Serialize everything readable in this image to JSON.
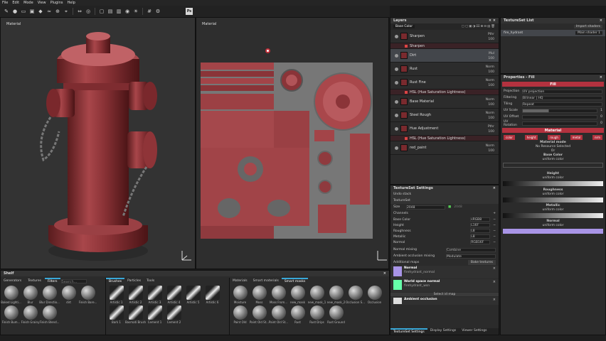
{
  "menu": [
    "File",
    "Edit",
    "Mode",
    "View",
    "Plugins",
    "Help"
  ],
  "toolbar": {
    "ps_label": "Ps"
  },
  "viewport3d": {
    "label": "Material"
  },
  "viewport2d": {
    "label": "Material"
  },
  "layers": {
    "title": "Layers",
    "channel": "Base Color",
    "items": [
      {
        "name": "Sharpen",
        "blend": "Pthr",
        "opacity": "100",
        "sub": false,
        "selected": false
      },
      {
        "name": "Sharpen",
        "blend": "",
        "opacity": "",
        "sub": true,
        "selected": false
      },
      {
        "name": "Dirt",
        "blend": "Mul",
        "opacity": "100",
        "sub": false,
        "selected": true
      },
      {
        "name": "Rust",
        "blend": "Norm",
        "opacity": "100",
        "sub": false,
        "selected": false
      },
      {
        "name": "Rust Fine",
        "blend": "Norm",
        "opacity": "100",
        "sub": false,
        "selected": false
      },
      {
        "name": "HSL (Hue Saturation Lightness)",
        "blend": "",
        "opacity": "",
        "sub": true,
        "selected": false
      },
      {
        "name": "Base Material",
        "blend": "Norm",
        "opacity": "100",
        "sub": false,
        "selected": false
      },
      {
        "name": "Steel Rough",
        "blend": "Norm",
        "opacity": "100",
        "sub": false,
        "selected": false
      },
      {
        "name": "Hue Adjustment",
        "blend": "Pthr",
        "opacity": "100",
        "sub": false,
        "selected": false
      },
      {
        "name": "HSL (Hue Saturation Lightness)",
        "blend": "",
        "opacity": "",
        "sub": true,
        "selected": false
      },
      {
        "name": "red_paint",
        "blend": "Norm",
        "opacity": "100",
        "sub": false,
        "selected": false
      }
    ]
  },
  "textureset_list": {
    "title": "TextureSet List",
    "import_label": "Import shaders",
    "item": "fire_hydrant",
    "shader": "Main shader 1"
  },
  "properties": {
    "title": "Properties - Fill",
    "fill_label": "Fill",
    "projection_label": "Projection",
    "projection_value": "UV projection",
    "filtering_label": "Filtering",
    "filtering_value": "Bilinear | HQ",
    "tiling_label": "Tiling",
    "tiling_value": "Repeat",
    "uvscale_label": "UV Scale",
    "uvscale_value": "1",
    "uvoffset_label": "UV Offset",
    "uvoffset_value": "0",
    "uvrotation_label": "UV Rotation",
    "uvrotation_value": "0",
    "material_label": "Material",
    "chips": [
      "color",
      "height",
      "rough",
      "metal",
      "nrm"
    ],
    "material_mode": "Material mode",
    "no_resource": "No Resource Selected",
    "or": "Or",
    "base_color": "Base Color",
    "uniform1": "uniform color",
    "height": "Height",
    "uniform2": "uniform color",
    "roughness": "Roughness",
    "uniform3": "uniform color",
    "metallic": "Metallic",
    "uniform4": "uniform color",
    "normal": "Normal",
    "uniform5": "uniform color"
  },
  "tss": {
    "title": "TextureSet Settings",
    "undo": "Undo stack",
    "textureset": "TextureSet",
    "size_label": "Size",
    "size_value": "2048",
    "size_value2": "2048",
    "channels_label": "Channels",
    "channels": [
      {
        "name": "Base Color",
        "fmt": "sRGB8"
      },
      {
        "name": "Height",
        "fmt": "L16F"
      },
      {
        "name": "Roughness",
        "fmt": "L8"
      },
      {
        "name": "Metallic",
        "fmt": "L8"
      },
      {
        "name": "Normal",
        "fmt": "RGB16F"
      }
    ],
    "normal_mixing_label": "Normal mixing",
    "normal_mixing_value": "Combine",
    "ao_mixing_label": "Ambient occlusion mixing",
    "ao_mixing_value": "Modulate",
    "additional_maps": "Additional maps",
    "bake_label": "Bake textures",
    "maps": [
      {
        "title": "Normal",
        "file": "firehydrant_normal"
      },
      {
        "title": "World space normal",
        "file": "firehydrant_wsn"
      },
      {
        "title": "Ambient occlusion",
        "file": ""
      }
    ],
    "select_map": "Select id map",
    "tabs": [
      "TextureSet Settings",
      "Display Settings",
      "Viewer Settings"
    ]
  },
  "shelf": {
    "title": "Shelf",
    "left_tabs": [
      "Generators",
      "Textures",
      "Filters"
    ],
    "search": "Search...",
    "left_items": [
      "Baked Lighti...",
      "Blur",
      "Blur Directio...",
      "dirt",
      "Finish Bare...",
      "Finish Bum...",
      "Finish Grainy",
      "Finish Blend..."
    ],
    "mid_tabs": [
      "Brushes",
      "Particles",
      "Tools"
    ],
    "mid_items": [
      "Artistic 1",
      "Artistic 2",
      "Artistic 3",
      "Artistic 4",
      "Artistic 5",
      "Artistic 6",
      "Bark 1",
      "Basmati Brush",
      "Cement 1",
      "Cement 2"
    ],
    "right_tabs": [
      "Materials",
      "Smart materials",
      "Smart masks"
    ],
    "right_items": [
      "Moisture",
      "Moss",
      "Moss From...",
      "new_mask",
      "new_mask_1",
      "new_mask_2",
      "Occlusion S...",
      "Occlusion",
      "Paint Old",
      "Paint Old St...",
      "Paint Old St...",
      "Rust",
      "Rust Drips",
      "Rust Ground"
    ]
  },
  "colors": {
    "accent": "#b3323f",
    "blue": "#39a8d8",
    "purple": "#a894e6"
  }
}
